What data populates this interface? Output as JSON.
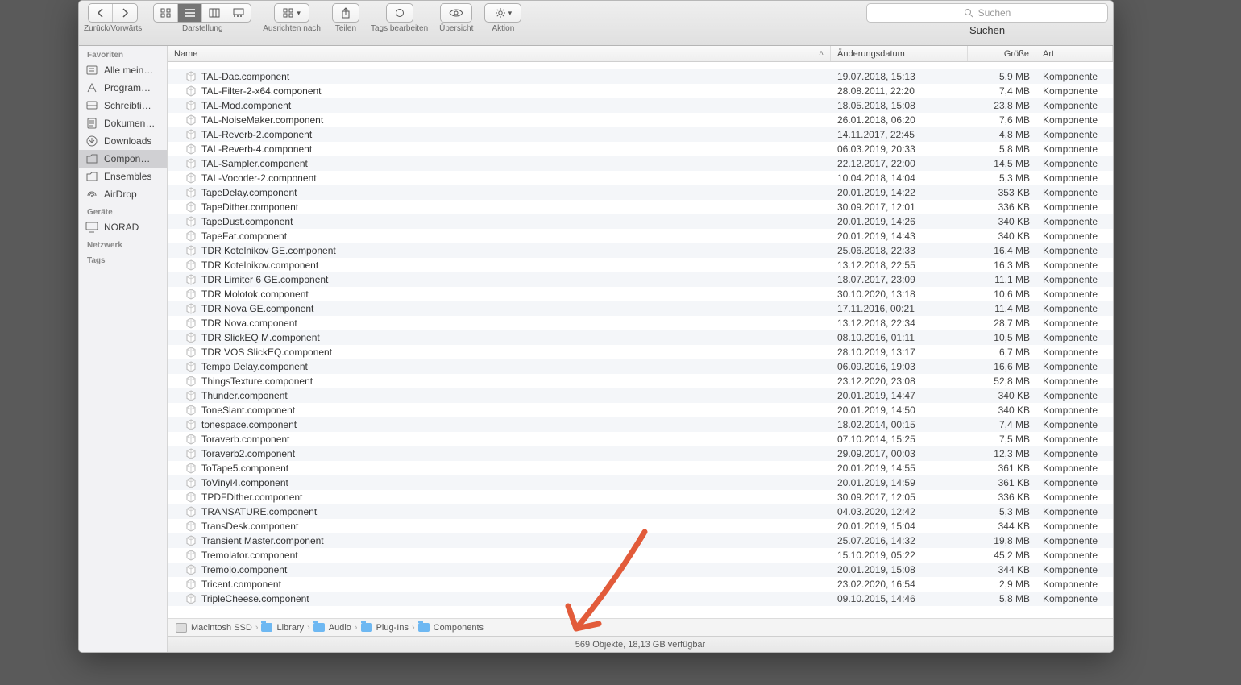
{
  "toolbar": {
    "back_fwd_label": "Zurück/Vorwärts",
    "view_label": "Darstellung",
    "arrange_label": "Ausrichten nach",
    "share_label": "Teilen",
    "tags_label": "Tags bearbeiten",
    "overview_label": "Übersicht",
    "action_label": "Aktion",
    "search_label": "Suchen",
    "search_placeholder": "Suchen"
  },
  "columns": {
    "name": "Name",
    "date": "Änderungsdatum",
    "size": "Größe",
    "kind": "Art"
  },
  "sidebar": {
    "favoriten_label": "Favoriten",
    "geraete_label": "Geräte",
    "netzwerk_label": "Netzwerk",
    "tags_label": "Tags",
    "items": [
      {
        "label": "Alle mein…"
      },
      {
        "label": "Program…"
      },
      {
        "label": "Schreibti…"
      },
      {
        "label": "Dokumen…"
      },
      {
        "label": "Downloads"
      },
      {
        "label": "Compon…"
      },
      {
        "label": "Ensembles"
      },
      {
        "label": "AirDrop"
      }
    ],
    "norad_label": "NORAD"
  },
  "files": [
    {
      "name": "TAL-Dac.component",
      "date": "19.07.2018, 15:13",
      "size": "5,9 MB",
      "kind": "Komponente"
    },
    {
      "name": "TAL-Filter-2-x64.component",
      "date": "28.08.2011, 22:20",
      "size": "7,4 MB",
      "kind": "Komponente"
    },
    {
      "name": "TAL-Mod.component",
      "date": "18.05.2018, 15:08",
      "size": "23,8 MB",
      "kind": "Komponente"
    },
    {
      "name": "TAL-NoiseMaker.component",
      "date": "26.01.2018, 06:20",
      "size": "7,6 MB",
      "kind": "Komponente"
    },
    {
      "name": "TAL-Reverb-2.component",
      "date": "14.11.2017, 22:45",
      "size": "4,8 MB",
      "kind": "Komponente"
    },
    {
      "name": "TAL-Reverb-4.component",
      "date": "06.03.2019, 20:33",
      "size": "5,8 MB",
      "kind": "Komponente"
    },
    {
      "name": "TAL-Sampler.component",
      "date": "22.12.2017, 22:00",
      "size": "14,5 MB",
      "kind": "Komponente"
    },
    {
      "name": "TAL-Vocoder-2.component",
      "date": "10.04.2018, 14:04",
      "size": "5,3 MB",
      "kind": "Komponente"
    },
    {
      "name": "TapeDelay.component",
      "date": "20.01.2019, 14:22",
      "size": "353 KB",
      "kind": "Komponente"
    },
    {
      "name": "TapeDither.component",
      "date": "30.09.2017, 12:01",
      "size": "336 KB",
      "kind": "Komponente"
    },
    {
      "name": "TapeDust.component",
      "date": "20.01.2019, 14:26",
      "size": "340 KB",
      "kind": "Komponente"
    },
    {
      "name": "TapeFat.component",
      "date": "20.01.2019, 14:43",
      "size": "340 KB",
      "kind": "Komponente"
    },
    {
      "name": "TDR Kotelnikov GE.component",
      "date": "25.06.2018, 22:33",
      "size": "16,4 MB",
      "kind": "Komponente"
    },
    {
      "name": "TDR Kotelnikov.component",
      "date": "13.12.2018, 22:55",
      "size": "16,3 MB",
      "kind": "Komponente"
    },
    {
      "name": "TDR Limiter 6 GE.component",
      "date": "18.07.2017, 23:09",
      "size": "11,1 MB",
      "kind": "Komponente"
    },
    {
      "name": "TDR Molotok.component",
      "date": "30.10.2020, 13:18",
      "size": "10,6 MB",
      "kind": "Komponente"
    },
    {
      "name": "TDR Nova GE.component",
      "date": "17.11.2016, 00:21",
      "size": "11,4 MB",
      "kind": "Komponente"
    },
    {
      "name": "TDR Nova.component",
      "date": "13.12.2018, 22:34",
      "size": "28,7 MB",
      "kind": "Komponente"
    },
    {
      "name": "TDR SlickEQ M.component",
      "date": "08.10.2016, 01:11",
      "size": "10,5 MB",
      "kind": "Komponente"
    },
    {
      "name": "TDR VOS SlickEQ.component",
      "date": "28.10.2019, 13:17",
      "size": "6,7 MB",
      "kind": "Komponente"
    },
    {
      "name": "Tempo Delay.component",
      "date": "06.09.2016, 19:03",
      "size": "16,6 MB",
      "kind": "Komponente"
    },
    {
      "name": "ThingsTexture.component",
      "date": "23.12.2020, 23:08",
      "size": "52,8 MB",
      "kind": "Komponente"
    },
    {
      "name": "Thunder.component",
      "date": "20.01.2019, 14:47",
      "size": "340 KB",
      "kind": "Komponente"
    },
    {
      "name": "ToneSlant.component",
      "date": "20.01.2019, 14:50",
      "size": "340 KB",
      "kind": "Komponente"
    },
    {
      "name": "tonespace.component",
      "date": "18.02.2014, 00:15",
      "size": "7,4 MB",
      "kind": "Komponente"
    },
    {
      "name": "Toraverb.component",
      "date": "07.10.2014, 15:25",
      "size": "7,5 MB",
      "kind": "Komponente"
    },
    {
      "name": "Toraverb2.component",
      "date": "29.09.2017, 00:03",
      "size": "12,3 MB",
      "kind": "Komponente"
    },
    {
      "name": "ToTape5.component",
      "date": "20.01.2019, 14:55",
      "size": "361 KB",
      "kind": "Komponente"
    },
    {
      "name": "ToVinyl4.component",
      "date": "20.01.2019, 14:59",
      "size": "361 KB",
      "kind": "Komponente"
    },
    {
      "name": "TPDFDither.component",
      "date": "30.09.2017, 12:05",
      "size": "336 KB",
      "kind": "Komponente"
    },
    {
      "name": "TRANSATURE.component",
      "date": "04.03.2020, 12:42",
      "size": "5,3 MB",
      "kind": "Komponente"
    },
    {
      "name": "TransDesk.component",
      "date": "20.01.2019, 15:04",
      "size": "344 KB",
      "kind": "Komponente"
    },
    {
      "name": "Transient Master.component",
      "date": "25.07.2016, 14:32",
      "size": "19,8 MB",
      "kind": "Komponente"
    },
    {
      "name": "Tremolator.component",
      "date": "15.10.2019, 05:22",
      "size": "45,2 MB",
      "kind": "Komponente"
    },
    {
      "name": "Tremolo.component",
      "date": "20.01.2019, 15:08",
      "size": "344 KB",
      "kind": "Komponente"
    },
    {
      "name": "Tricent.component",
      "date": "23.02.2020, 16:54",
      "size": "2,9 MB",
      "kind": "Komponente"
    },
    {
      "name": "TripleCheese.component",
      "date": "09.10.2015, 14:46",
      "size": "5,8 MB",
      "kind": "Komponente"
    }
  ],
  "path": [
    {
      "label": "Macintosh SSD",
      "icon": "hd"
    },
    {
      "label": "Library",
      "icon": "fld"
    },
    {
      "label": "Audio",
      "icon": "fld"
    },
    {
      "label": "Plug-Ins",
      "icon": "fld"
    },
    {
      "label": "Components",
      "icon": "fld"
    }
  ],
  "status": "569 Objekte, 18,13 GB verfügbar"
}
